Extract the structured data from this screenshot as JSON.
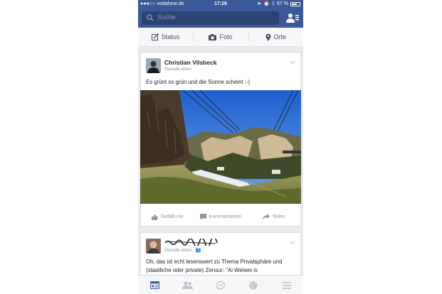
{
  "status_bar": {
    "carrier": "●●●○○ vodafone.de",
    "time": "17:26",
    "battery": "67 %"
  },
  "search": {
    "placeholder": "Suche"
  },
  "composer": {
    "items": [
      {
        "label": "Status",
        "icon": "edit-icon"
      },
      {
        "label": "Foto",
        "icon": "camera-icon"
      },
      {
        "label": "Orte",
        "icon": "location-pin-icon"
      }
    ]
  },
  "posts": [
    {
      "author": "Christian Vilsbeck",
      "time": "Gerade eben",
      "text": "Es grünt so grün und die Sonne scheint :-)",
      "actions": [
        "Gefällt mir",
        "Kommentieren",
        "Teilen"
      ]
    },
    {
      "time": "Gerade eben · 👥",
      "text": "Oh, das ist echt lesenswert zu Thema Privatsphäre und (staatliche oder private) Zensur: \"Ai Weiwei is"
    }
  ],
  "colors": {
    "brand": "#3b5998",
    "brand_dark": "#2d4373",
    "tab_active": "#4267b2",
    "tab_inactive": "#bec3c9"
  },
  "tabs": [
    "news-feed-icon",
    "friends-icon",
    "messenger-icon",
    "globe-icon",
    "menu-icon"
  ]
}
